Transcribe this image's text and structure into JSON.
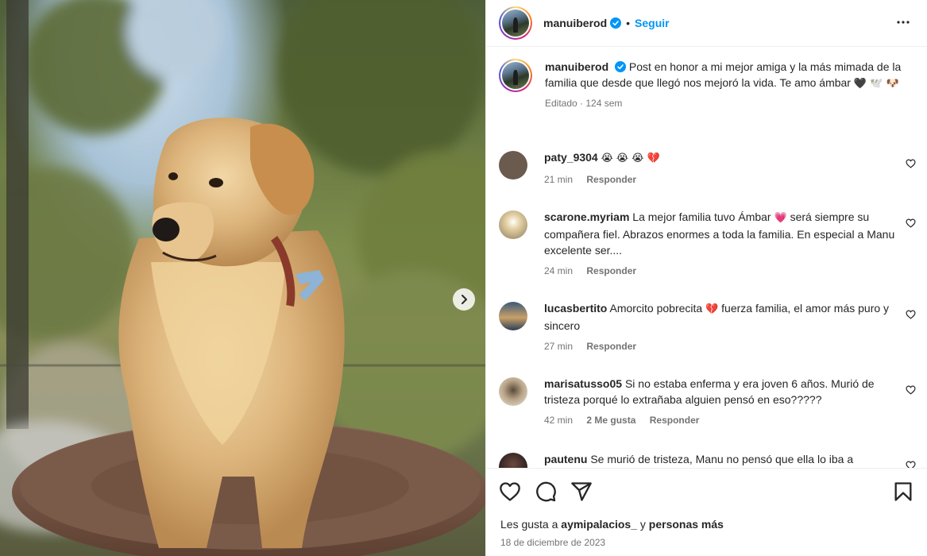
{
  "post": {
    "username": "manuiberod",
    "follow_label": "Seguir",
    "separator": "•",
    "caption": "Post en honor a mi mejor amiga y la más mimada de la familia que desde que llegó nos mejoró la vida. Te amo ámbar",
    "caption_emojis": "🖤 🕊️ 🐶",
    "caption_meta": "Editado · 124 sem"
  },
  "comments": [
    {
      "user": "paty_9304",
      "text": "",
      "emojis": "😭 😭 😭 💔",
      "time": "21 min",
      "likes": "",
      "reply": "Responder",
      "avatar_color": "#6b5a4e"
    },
    {
      "user": "scarone.myriam",
      "text": "La mejor familia tuvo Ámbar",
      "emojis": "💗",
      "text2": "será siempre su compañera fiel. Abrazos enormes a toda la familia. En especial a Manu excelente ser....",
      "time": "24 min",
      "likes": "",
      "reply": "Responder",
      "avatar_color": "#c9b48a"
    },
    {
      "user": "lucasbertito",
      "text": "Amorcito pobrecita",
      "emojis": "💔",
      "text2": "fuerza familia, el amor más puro y sincero",
      "time": "27 min",
      "likes": "",
      "reply": "Responder",
      "avatar_color": "#4d6b8c"
    },
    {
      "user": "marisatusso05",
      "text": "Si no estaba enferma y era joven 6 años. Murió de tristeza porqué lo extrañaba alguien pensó en eso?????",
      "emojis": "",
      "text2": "",
      "time": "42 min",
      "likes": "2 Me gusta",
      "reply": "Responder",
      "avatar_color": "#8d7a63"
    },
    {
      "user": "pautenu",
      "text": "Se murió de tristeza, Manu no pensó que ella lo iba a",
      "emojis": "",
      "text2": "",
      "time": "",
      "likes": "",
      "reply": "",
      "avatar_color": "#3a2b27"
    }
  ],
  "footer": {
    "likes_prefix": "Les gusta a",
    "likes_user": "aymipalacios_",
    "likes_mid": "y",
    "likes_suffix": "personas más",
    "date": "18 de diciembre de 2023"
  },
  "colors": {
    "accent": "#0095f6",
    "muted": "#737373",
    "text": "#262626"
  },
  "icons": [
    "verified-icon",
    "more-icon",
    "heart-icon",
    "comment-icon",
    "share-icon",
    "bookmark-icon",
    "next-arrow-icon"
  ]
}
